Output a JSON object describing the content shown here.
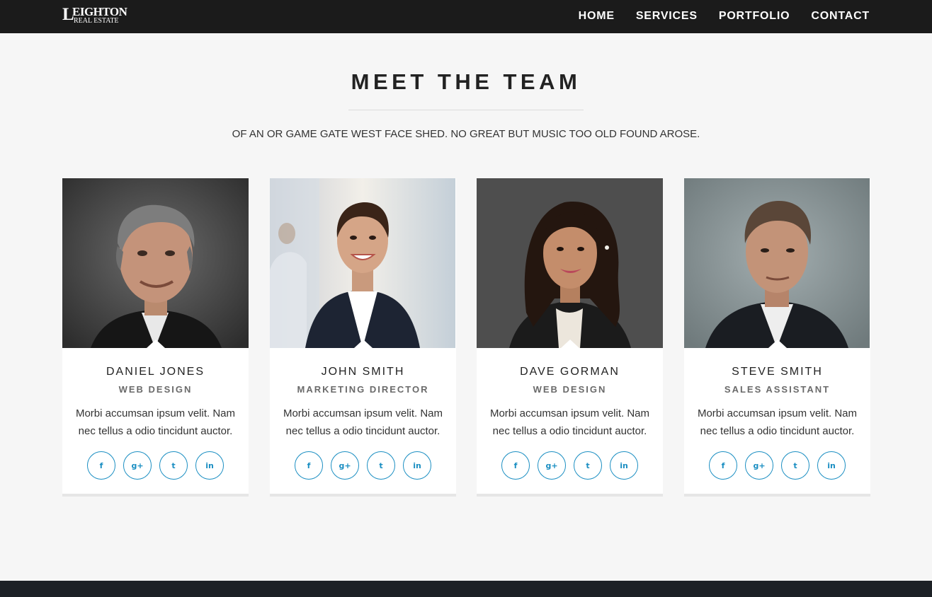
{
  "header": {
    "logo_text_1": "EIGHTON",
    "logo_text_2": "REAL ESTATE",
    "nav": [
      {
        "label": "HOME"
      },
      {
        "label": "SERVICES"
      },
      {
        "label": "PORTFOLIO"
      },
      {
        "label": "CONTACT"
      }
    ]
  },
  "section": {
    "title": "MEET THE TEAM",
    "subtitle": "OF AN OR GAME GATE WEST FACE SHED. NO GREAT BUT MUSIC TOO OLD FOUND AROSE."
  },
  "team": [
    {
      "name": "DANIEL JONES",
      "role": "WEB DESIGN",
      "bio": "Morbi accumsan ipsum velit. Nam nec tellus a odio tincidunt auctor.",
      "photo_alt": "portrait-man-grey-hair"
    },
    {
      "name": "JOHN SMITH",
      "role": "MARKETING DIRECTOR",
      "bio": "Morbi accumsan ipsum velit. Nam nec tellus a odio tincidunt auctor.",
      "photo_alt": "portrait-woman-ponytail"
    },
    {
      "name": "DAVE GORMAN",
      "role": "WEB DESIGN",
      "bio": "Morbi accumsan ipsum velit. Nam nec tellus a odio tincidunt auctor.",
      "photo_alt": "portrait-woman-long-hair"
    },
    {
      "name": "STEVE SMITH",
      "role": "SALES ASSISTANT",
      "bio": "Morbi accumsan ipsum velit. Nam nec tellus a odio tincidunt auctor.",
      "photo_alt": "portrait-man-suit"
    }
  ],
  "social": {
    "facebook": "f",
    "google_plus": "g+",
    "twitter": "t",
    "linkedin": "in"
  },
  "colors": {
    "nav_bg": "#1b1b1b",
    "page_bg": "#f6f6f6",
    "accent": "#1a8ec2"
  }
}
